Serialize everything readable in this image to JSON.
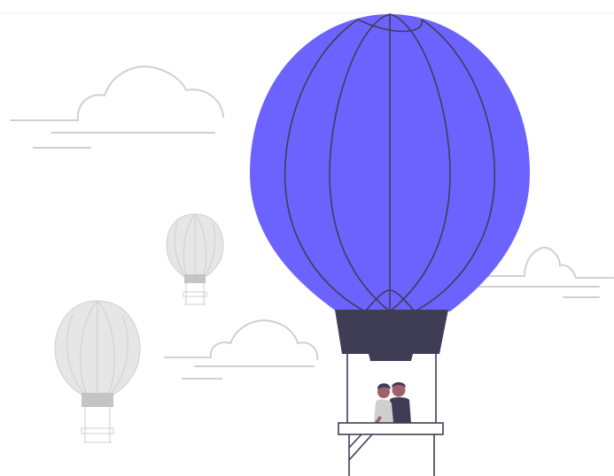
{
  "illustration": {
    "subject": "hot-air-balloon-couple",
    "colors": {
      "background": "#ffffff",
      "balloon_main": "#6c63ff",
      "dark": "#3f3d56",
      "cloud_line": "#d0d0d0",
      "small_balloon_fill": "#e6e6e6",
      "small_balloon_line": "#cfcfcf",
      "small_balloon_basket": "#c4c4c4",
      "person_skin": "#a0616a",
      "person_light_shirt": "#cfcfcf"
    },
    "icons": [
      "cloud-icon",
      "hot-air-balloon-icon",
      "couple-icon"
    ]
  }
}
